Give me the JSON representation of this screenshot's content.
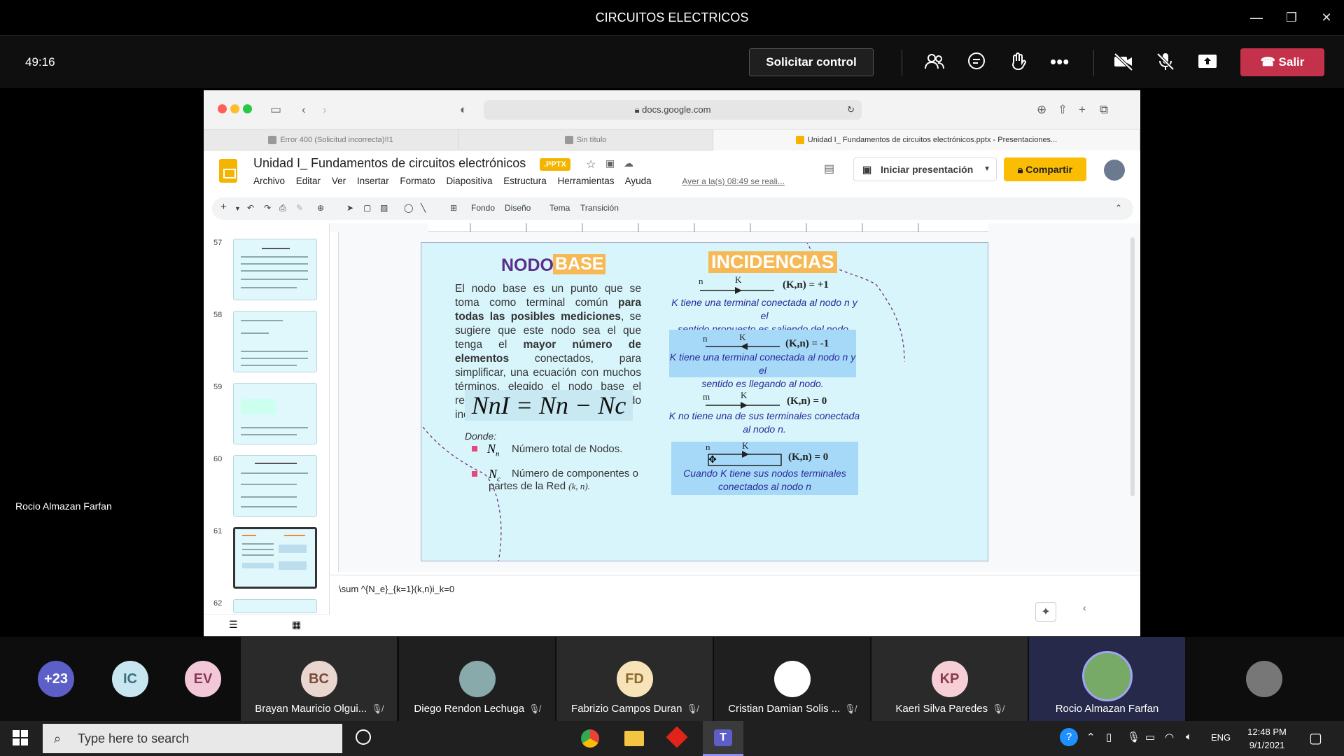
{
  "window": {
    "title": "CIRCUITOS ELECTRICOS"
  },
  "meeting": {
    "timer": "49:16",
    "request_control": "Solicitar control",
    "leave": "Salir",
    "presenter": "Rocio Almazan Farfan"
  },
  "browser": {
    "url": "docs.google.com",
    "tabs": [
      {
        "label": "Error 400 (Solicitud incorrecta)!!1"
      },
      {
        "label": "Sin título"
      },
      {
        "label": "Unidad I_ Fundamentos de circuitos electrónicos.pptx - Presentaciones..."
      }
    ]
  },
  "docs": {
    "title": "Unidad I_ Fundamentos de circuitos electrónicos",
    "badge": ".PPTX",
    "menus": [
      "Archivo",
      "Editar",
      "Ver",
      "Insertar",
      "Formato",
      "Diapositiva",
      "Estructura",
      "Herramientas",
      "Ayuda"
    ],
    "last_saved": "Ayer a la(s) 08:49 se reali...",
    "present": "Iniciar presentación",
    "share": "Compartir",
    "toolbar": {
      "fondo": "Fondo",
      "diseno": "Diseño",
      "tema": "Tema",
      "transicion": "Transición"
    },
    "slide_numbers": [
      "57",
      "58",
      "59",
      "60",
      "61",
      "62"
    ],
    "notes": "\\sum ^{N_e}_{k=1}(k,n)i_k=0"
  },
  "slide": {
    "title_a": "NODO",
    "title_b": "BASE",
    "incidencias": "INCIDENCIAS",
    "paragraph": "El nodo base es un punto que se toma como terminal común para todas las posibles mediciones, se sugiere que este nodo sea el que tenga el mayor número de elementos conectados, para simplificar, una ecuación con muchos términos, elegido el nodo base el resto se les llama nodo independientes y se les enumera.",
    "p_1": "El nodo base es un punto que se toma como terminal común ",
    "p_b1": "para todas las posibles mediciones",
    "p_2": ", se sugiere que este nodo sea el que tenga el ",
    "p_b2": "mayor número de elementos",
    "p_3": " conectados, para simplificar, una ecuación con muchos términos, elegido el nodo base el resto se les llama nodo independientes y se les enumera.",
    "formula": "NnI = Nn − Nc",
    "donde": "Donde:",
    "item1": "Número total de Nodos.",
    "item2a": "Número de componentes o",
    "item2b": "partes de la Red",
    "item2c": "(k, n).",
    "inc": [
      {
        "n": "n",
        "k": "K",
        "val": "(K,n) = +1",
        "desc1": "K tiene una terminal conectada al nodo n y el",
        "desc2": "sentido propuesto es saliendo del nodo."
      },
      {
        "n": "n",
        "k": "K",
        "val": "(K,n) = -1",
        "desc1": "K tiene una terminal conectada al nodo n y el",
        "desc2": "sentido es llegando al nodo."
      },
      {
        "n": "m",
        "k": "K",
        "val": "(K,n) = 0",
        "desc1": "K no tiene una de sus terminales conectada",
        "desc2": "al nodo n."
      },
      {
        "n": "n",
        "k": "K",
        "val": "(K,n) = 0",
        "desc1": "Cuando K tiene sus nodos terminales",
        "desc2": "conectados al nodo n"
      }
    ]
  },
  "participants": [
    {
      "initials": "+23",
      "name": "",
      "color": "#5b5fc7"
    },
    {
      "initials": "IC",
      "name": "",
      "color": "#c8e6ef"
    },
    {
      "initials": "EV",
      "name": "",
      "color": "#f2c8d8"
    },
    {
      "initials": "BC",
      "name": "Brayan Mauricio Olgui...",
      "color": "#e9d6cf"
    },
    {
      "initials": "",
      "name": "Diego Rendon Lechuga",
      "color": "#8aa"
    },
    {
      "initials": "FD",
      "name": "Fabrizio Campos Duran",
      "color": "#f8e3b8"
    },
    {
      "initials": "",
      "name": "Cristian Damian Solis ...",
      "color": "#fff"
    },
    {
      "initials": "KP",
      "name": "Kaeri Silva Paredes",
      "color": "#f6cfd6"
    },
    {
      "initials": "",
      "name": "Rocio Almazan Farfan",
      "color": "#7a6"
    },
    {
      "initials": "",
      "name": "",
      "color": "#777"
    }
  ],
  "taskbar": {
    "search_placeholder": "Type here to search",
    "lang": "ENG",
    "time": "12:48 PM",
    "date": "9/1/2021"
  }
}
